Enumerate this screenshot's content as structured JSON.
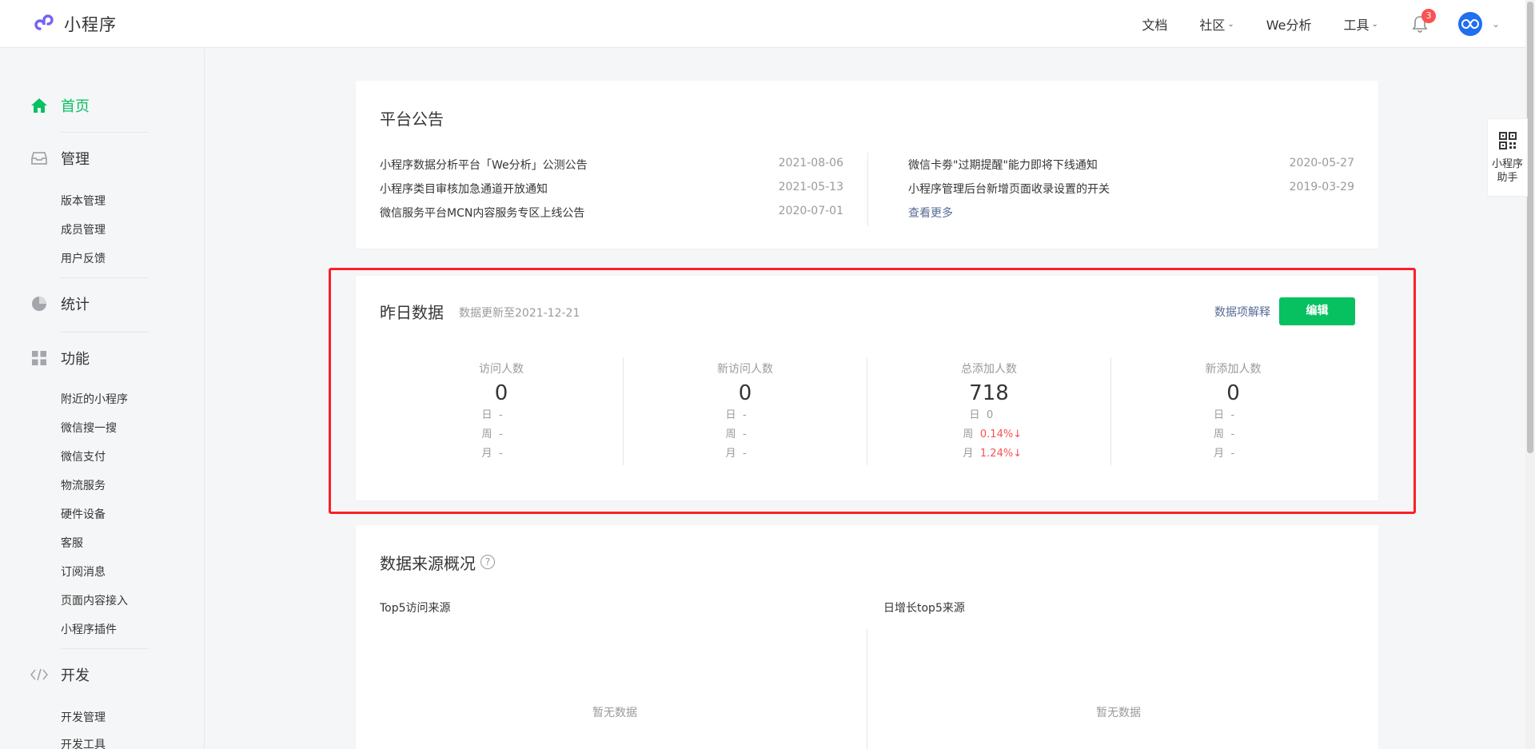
{
  "header": {
    "logo_text": "小程序",
    "nav": [
      {
        "label": "文档",
        "has_chevron": false
      },
      {
        "label": "社区",
        "has_chevron": true
      },
      {
        "label": "We分析",
        "has_chevron": false
      },
      {
        "label": "工具",
        "has_chevron": true
      }
    ],
    "notification_count": "3",
    "chevron": "⌄",
    "brand_color": "#07c160"
  },
  "sidebar": {
    "home": "首页",
    "manage": "管理",
    "manage_items": [
      "版本管理",
      "成员管理",
      "用户反馈"
    ],
    "stats": "统计",
    "features": "功能",
    "feature_items": [
      "附近的小程序",
      "微信搜一搜",
      "微信支付",
      "物流服务",
      "硬件设备",
      "客服",
      "订阅消息",
      "页面内容接入",
      "小程序插件"
    ],
    "dev": "开发",
    "dev_items": [
      "开发管理",
      "开发工具"
    ]
  },
  "announcement": {
    "title": "平台公告",
    "left": [
      {
        "text": "小程序数据分析平台「We分析」公测公告",
        "date": "2021-08-06"
      },
      {
        "text": "小程序类目审核加急通道开放通知",
        "date": "2021-05-13"
      },
      {
        "text": "微信服务平台MCN内容服务专区上线公告",
        "date": "2020-07-01"
      }
    ],
    "right": [
      {
        "text": "微信卡劵\"过期提醒\"能力即将下线通知",
        "date": "2020-05-27"
      },
      {
        "text": "小程序管理后台新增页面收录设置的开关",
        "date": "2019-03-29"
      }
    ],
    "more": "查看更多"
  },
  "yesterday": {
    "title": "昨日数据",
    "updated": "数据更新至2021-12-21",
    "explain_link": "数据项解释",
    "edit_button": "编辑",
    "stats": [
      {
        "label": "访问人数",
        "value": "0",
        "rows": [
          [
            "日",
            "-"
          ],
          [
            "周",
            "-"
          ],
          [
            "月",
            "-"
          ]
        ]
      },
      {
        "label": "新访问人数",
        "value": "0",
        "rows": [
          [
            "日",
            "-"
          ],
          [
            "周",
            "-"
          ],
          [
            "月",
            "-"
          ]
        ]
      },
      {
        "label": "总添加人数",
        "value": "718",
        "rows": [
          [
            "日",
            "0"
          ],
          [
            "周",
            "0.14%↓"
          ],
          [
            "月",
            "1.24%↓"
          ]
        ]
      },
      {
        "label": "新添加人数",
        "value": "0",
        "rows": [
          [
            "日",
            "-"
          ],
          [
            "周",
            "-"
          ],
          [
            "月",
            "-"
          ]
        ]
      }
    ]
  },
  "source": {
    "title": "数据来源概况",
    "help_icon": "?",
    "left_title": "Top5访问来源",
    "right_title": "日增长top5来源",
    "empty": "暂无数据"
  },
  "assistant": {
    "line1": "小程序",
    "line2": "助手"
  }
}
